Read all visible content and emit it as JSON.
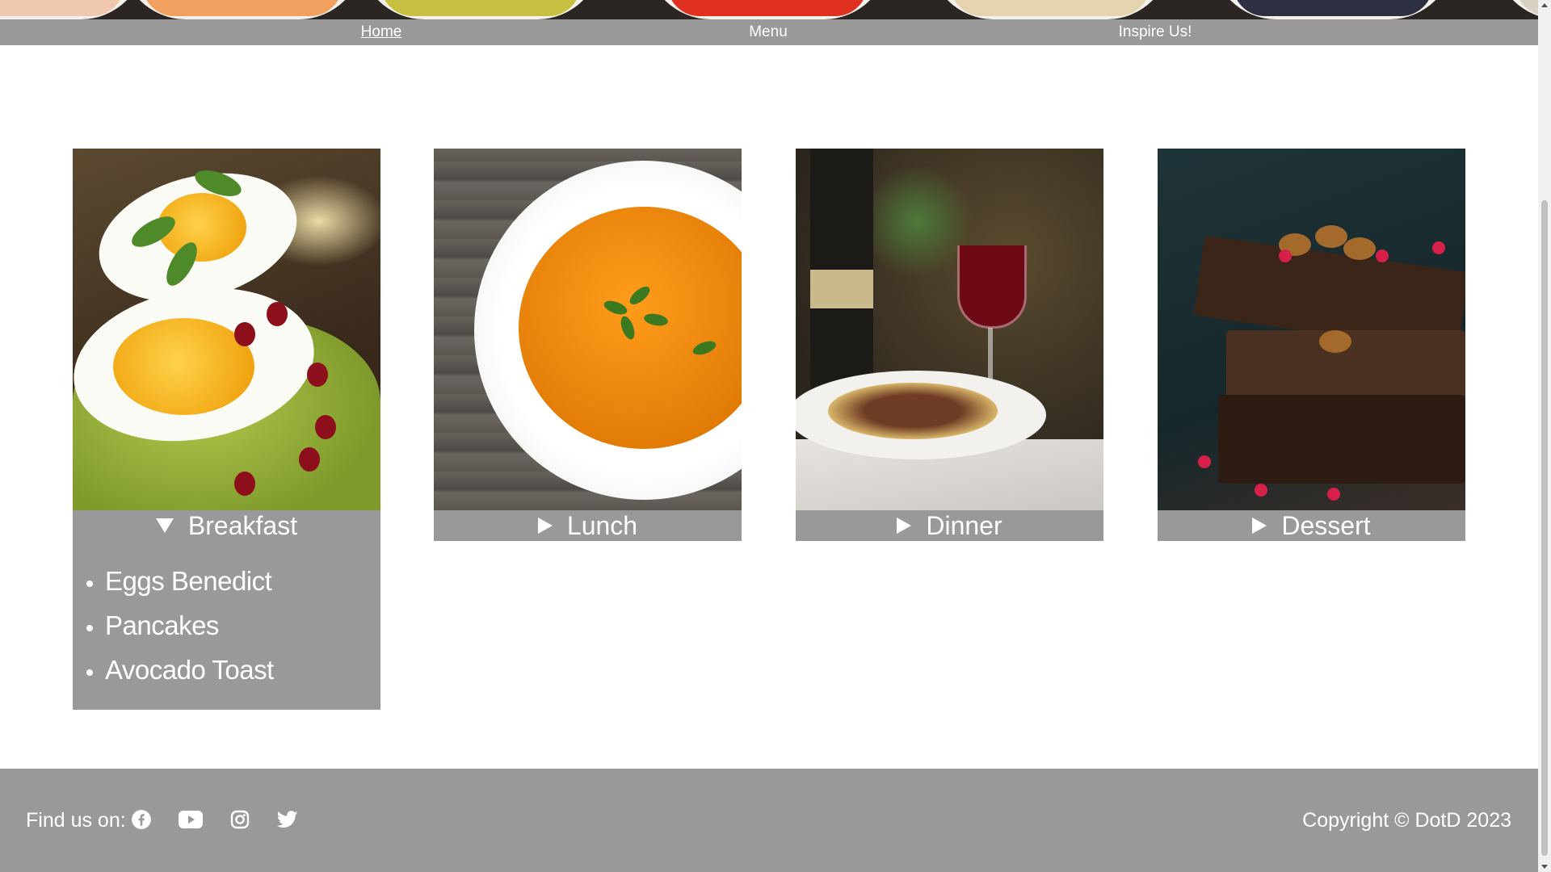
{
  "nav": {
    "items": [
      {
        "label": "Home",
        "active": true
      },
      {
        "label": "Menu",
        "active": false
      },
      {
        "label": "Inspire Us!",
        "active": false
      }
    ]
  },
  "cards": [
    {
      "title": "Breakfast",
      "expanded": true,
      "items": [
        "Eggs Benedict",
        "Pancakes",
        "Avocado Toast"
      ]
    },
    {
      "title": "Lunch",
      "expanded": false
    },
    {
      "title": "Dinner",
      "expanded": false
    },
    {
      "title": "Dessert",
      "expanded": false
    }
  ],
  "footer": {
    "find_label": "Find us on:",
    "social_icons": [
      "facebook-icon",
      "youtube-icon",
      "instagram-icon",
      "twitter-icon"
    ],
    "copyright": "Copyright © DotD 2023"
  },
  "colors": {
    "bar": "#999999",
    "text": "#ffffff",
    "banner": "#2b2624"
  }
}
